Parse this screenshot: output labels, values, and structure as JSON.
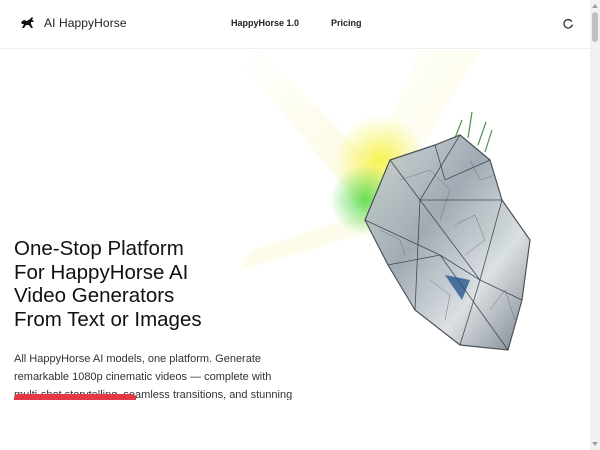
{
  "header": {
    "brand": "AI HappyHorse",
    "logo_icon": "horse-icon",
    "nav": [
      {
        "label": "HappyHorse 1.0"
      },
      {
        "label": "Pricing"
      }
    ],
    "loader_icon": "loading-spinner-icon"
  },
  "hero": {
    "headline": "One-Stop Platform\nFor HappyHorse AI\nVideo Generators\nFrom Text or Images",
    "description": "All HappyHorse AI models, one platform. Generate remarkable 1080p cinematic videos — complete with multi-shot storytelling, seamless transitions, and stunning realism.",
    "cta_color": "#e53945",
    "art_icon": "glass-crystal-illustration"
  },
  "colors": {
    "accent": "#e53945",
    "glow_green": "#34c724",
    "glow_yellow": "#f2ee3a"
  }
}
